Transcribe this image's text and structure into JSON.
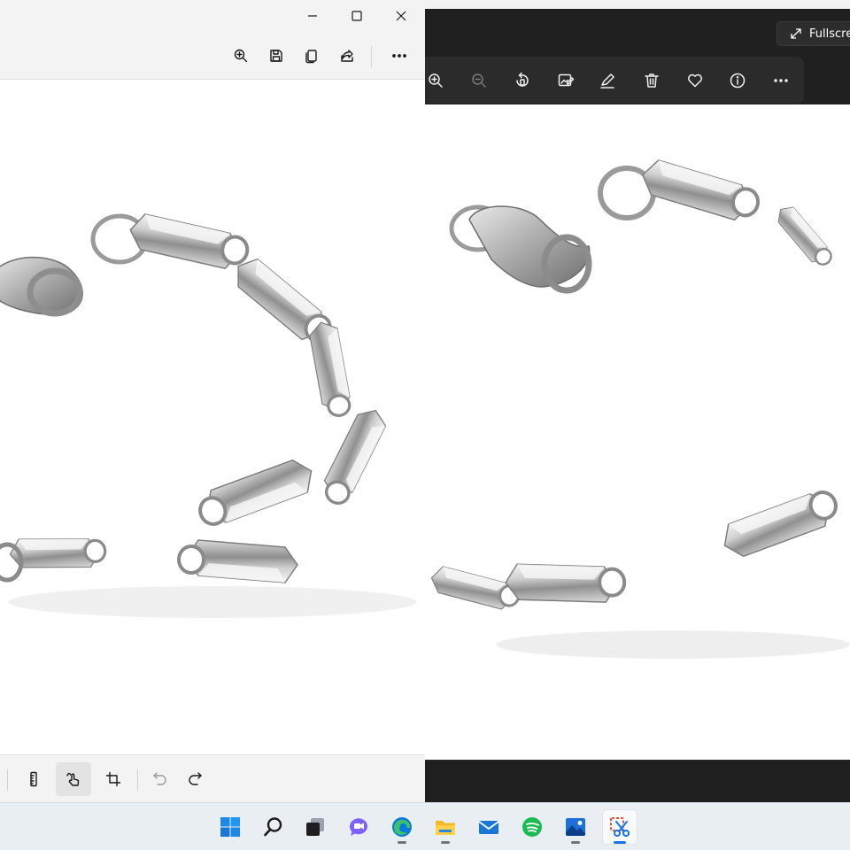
{
  "snipping_tool": {
    "window_controls": {
      "minimize": "minimize-icon",
      "maximize": "maximize-icon",
      "close": "close-icon"
    },
    "toolbar": [
      "zoom-in-icon",
      "save-icon",
      "copy-icon",
      "share-icon",
      "more-icon"
    ],
    "bottom_tools": [
      "ruler-icon",
      "touch-writing-icon",
      "crop-icon",
      "undo-icon",
      "redo-icon"
    ],
    "active_tool": "touch-writing-icon",
    "disabled_tools": [
      "undo-icon"
    ]
  },
  "photos_app": {
    "fullscreen_label": "Fullscre",
    "toolbar": [
      "zoom-in-icon",
      "zoom-out-icon",
      "rotate-icon",
      "edit-image-icon",
      "draw-icon",
      "delete-icon",
      "favorite-icon",
      "info-icon",
      "more-icon"
    ],
    "disabled_tools": [
      "zoom-out-icon"
    ]
  },
  "image": {
    "subject": "silver-link-bracelet-photo"
  },
  "taskbar": {
    "apps": [
      "start-icon",
      "search-icon",
      "task-view-icon",
      "teams-chat-icon",
      "edge-icon",
      "file-explorer-icon",
      "mail-icon",
      "spotify-icon",
      "photos-icon",
      "snipping-tool-icon"
    ],
    "active_app": "snipping-tool-icon"
  },
  "colors": {
    "light_chrome": "#f3f3f3",
    "dark_chrome": "#202020",
    "dark_toolbar": "#2b2b2b",
    "taskbar": "#e9eef3",
    "accent": "#1a73e8"
  }
}
